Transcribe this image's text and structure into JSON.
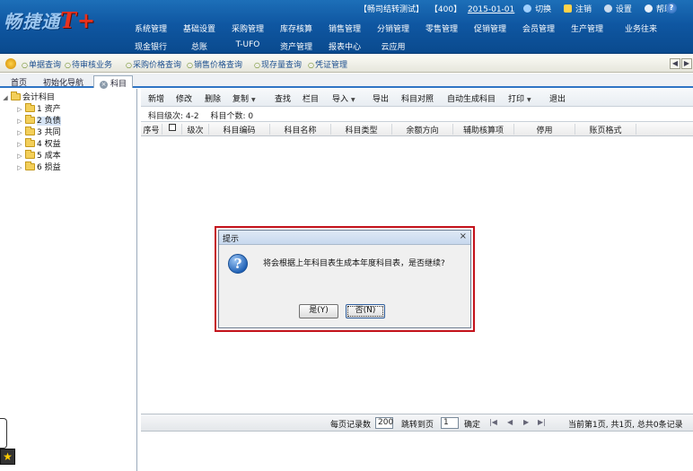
{
  "header": {
    "logo_text": "畅捷通",
    "logo_suffix": "T+",
    "account": "【畅司结转测试】",
    "user": "【400】",
    "date": "2015-01-01",
    "switch_label": "切换",
    "logout_label": "注销",
    "settings_label": "设置",
    "help_label": "帮助"
  },
  "main_menu": {
    "row1": [
      "系统管理",
      "基础设置",
      "采购管理",
      "库存核算",
      "销售管理",
      "分销管理",
      "零售管理",
      "促销管理",
      "会员管理",
      "生产管理",
      "业务往来"
    ],
    "row2": [
      "现金银行",
      "总账",
      "T-UFO",
      "资产管理",
      "报表中心",
      "云应用"
    ]
  },
  "quick_bar": {
    "items": [
      "单据查询",
      "待审核业务",
      "采购价格查询",
      "销售价格查询",
      "现存量查询",
      "凭证管理"
    ]
  },
  "tabs": [
    "首页",
    "初始化导航",
    "科目"
  ],
  "tree": {
    "root": "会计科目",
    "nodes": [
      "1 资产",
      "2 负债",
      "3 共同",
      "4 权益",
      "5 成本",
      "6 损益"
    ]
  },
  "toolbar": {
    "items": [
      "新增",
      "修改",
      "删除",
      "复制",
      "查找",
      "栏目",
      "导入",
      "导出",
      "科目对照",
      "自动生成科目",
      "打印",
      "退出"
    ]
  },
  "level_info": {
    "levels": "科目级次: 4-2",
    "count": "科目个数: 0"
  },
  "grid": {
    "columns": [
      "序号",
      "",
      "级次",
      "科目编码",
      "科目名称",
      "科目类型",
      "余额方向",
      "辅助核算项",
      "停用",
      "账页格式"
    ]
  },
  "pager": {
    "per_page_label": "每页记录数",
    "per_page_value": "200",
    "jump_label": "跳转到页",
    "jump_value": "1",
    "confirm_label": "确定",
    "status": "当前第1页, 共1页, 总共0条记录"
  },
  "dialog": {
    "title": "提示",
    "message": "将会根据上年科目表生成本年度科目表，是否继续?",
    "yes_label": "是(Y)",
    "no_label": "否(N)"
  },
  "colors": {
    "header_blue": "#0f57a2",
    "dialog_frame": "#c4121b",
    "tab_accent": "#2e74c4"
  }
}
